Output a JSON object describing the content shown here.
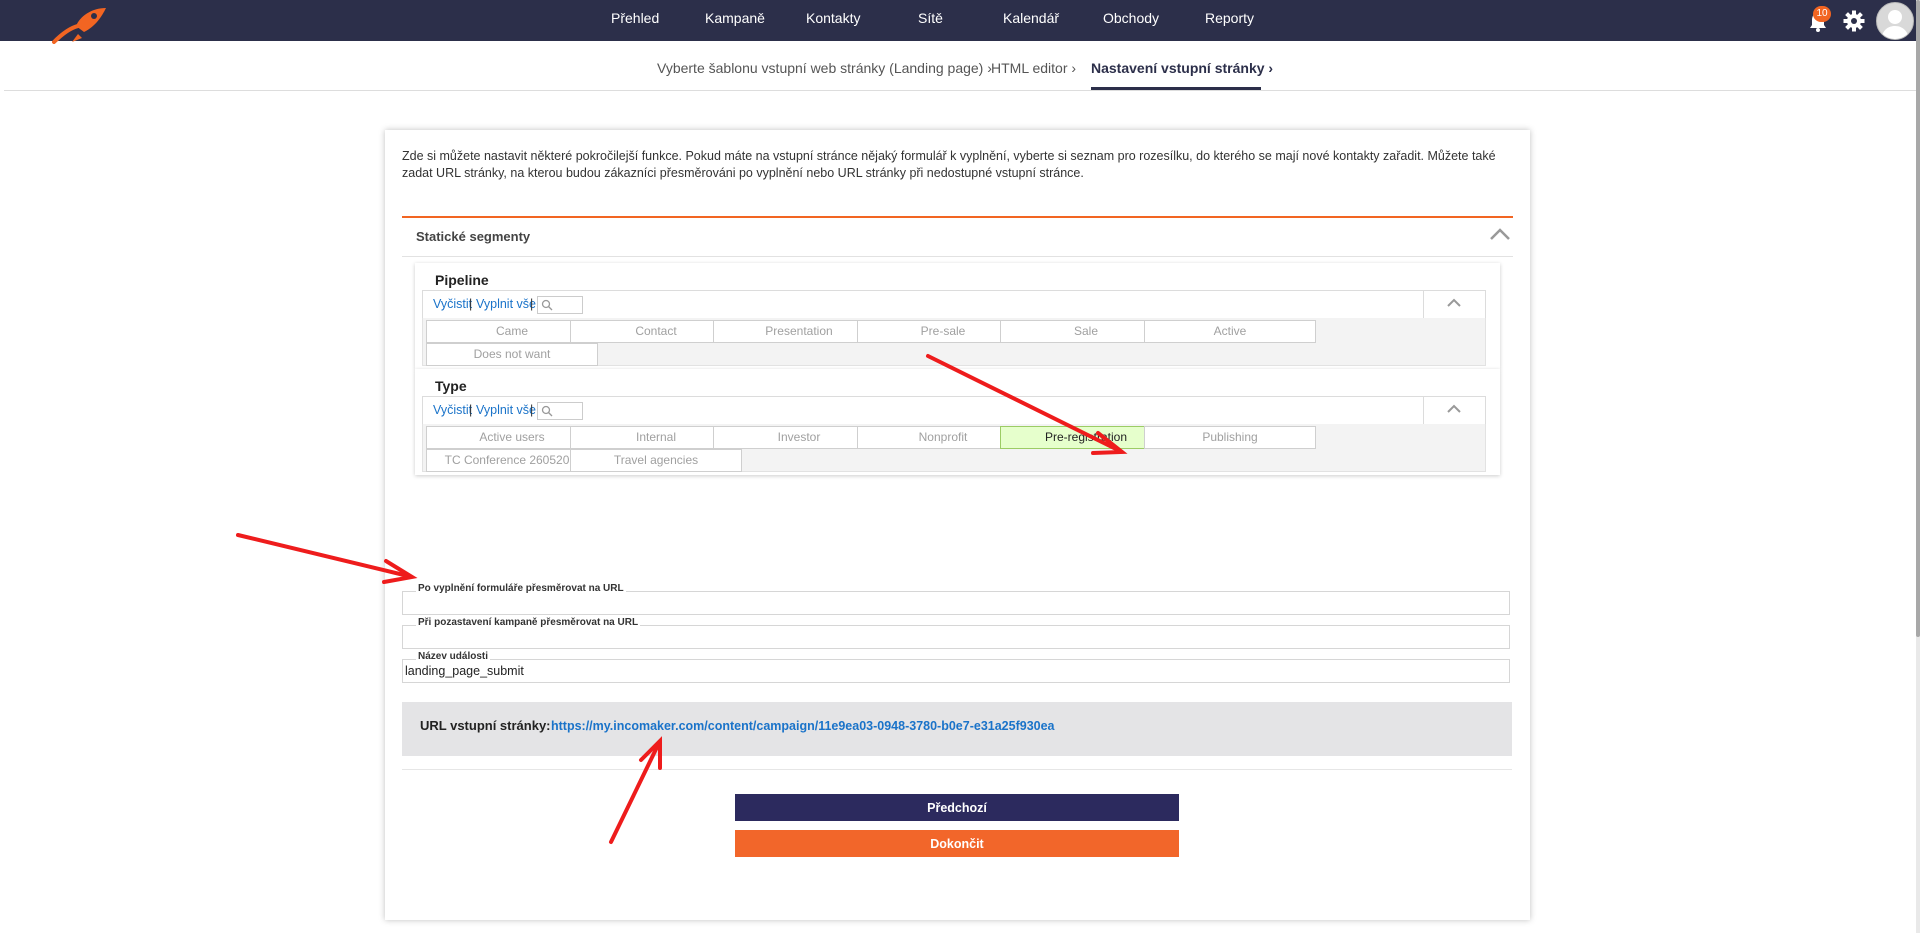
{
  "nav": {
    "items": [
      "Přehled",
      "Kampaně",
      "Kontakty",
      "Sítě",
      "Kalendář",
      "Obchody",
      "Reporty"
    ],
    "notification_count": "10",
    "accent_color": "#f26522",
    "nav_color": "#2c2f4a"
  },
  "breadcrumb": {
    "steps": [
      "Vyberte šablonu vstupní web stránky (Landing page)",
      "HTML editor",
      "Nastavení vstupní stránky"
    ],
    "separator": "›"
  },
  "intro_text": "Zde si můžete nastavit některé pokročilejší funkce. Pokud máte na vstupní stránce nějaký formulář k vyplnění, vyberte si seznam pro rozesílku, do kterého se mají nové kontakty zařadit. Můžete také zadat URL stránky, na kterou budou zákazníci přesměrováni po vyplnění nebo URL stránky při nedostupné vstupní stránce.",
  "segments": {
    "title": "Statické segmenty",
    "clear_label": "Vyčistit",
    "fill_all_label": "Vyplnit vše",
    "separator": "|",
    "groups": [
      {
        "title": "Pipeline",
        "chips": [
          "Came",
          "Contact",
          "Presentation",
          "Pre-sale",
          "Sale",
          "Active",
          "Does not want"
        ]
      },
      {
        "title": "Type",
        "chips": [
          "Active users",
          "Internal",
          "Investor",
          "Nonprofit",
          "Pre-registration",
          "Publishing",
          "TC Conference 260520...",
          "Travel agencies"
        ],
        "selected": "Pre-registration"
      }
    ]
  },
  "fields": {
    "redirect_after_form_label": "Po vyplnění formuláře přesměrovat na URL",
    "redirect_after_form_value": "",
    "redirect_paused_label": "Při pozastavení kampaně přesměrovat na URL",
    "redirect_paused_value": "",
    "event_name_label": "Název události",
    "event_name_value": "landing_page_submit"
  },
  "landing_url": {
    "label": "URL vstupní stránky:",
    "url": "https://my.incomaker.com/content/campaign/11e9ea03-0948-3780-b0e7-e31a25f930ea"
  },
  "buttons": {
    "previous_label": "Předchozí",
    "finish_label": "Dokončit"
  },
  "annotation_arrow_color": "#ee1c1c"
}
